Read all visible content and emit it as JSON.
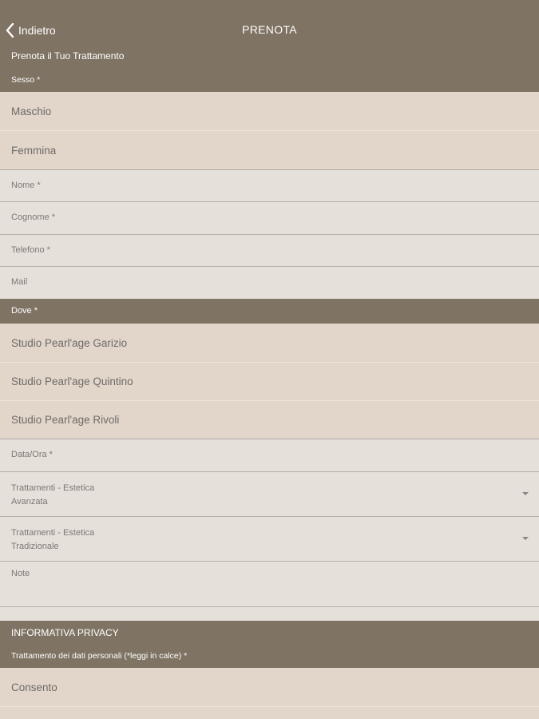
{
  "nav": {
    "back_label": "Indietro",
    "title": "PRENOTA"
  },
  "form": {
    "heading": "Prenota il Tuo Trattamento",
    "sesso": {
      "label": "Sesso *",
      "options": [
        "Maschio",
        "Femmina"
      ]
    },
    "nome": {
      "label": "Nome *"
    },
    "cognome": {
      "label": "Cognome *"
    },
    "telefono": {
      "label": "Telefono *"
    },
    "mail": {
      "label": "Mail"
    },
    "dove": {
      "label": "Dove *",
      "options": [
        "Studio Pearl'age Garizio",
        "Studio Pearl'age Quintino",
        "Studio Pearl'age Rivoli"
      ]
    },
    "data_ora": {
      "label": "Data/Ora *"
    },
    "trattamenti_avanzata": {
      "label": "Trattamenti - Estetica\nAvanzata"
    },
    "trattamenti_tradizionale": {
      "label": "Trattamenti - Estetica\nTradizionale"
    },
    "note": {
      "label": "Note"
    },
    "privacy": {
      "heading": "INFORMATIVA PRIVACY",
      "label": "Trattamento dei dati personali (*leggi in calce) *",
      "options": [
        "Consento"
      ]
    }
  },
  "colors": {
    "header_bg": "#7f7364",
    "option_bg": "#e2d6cb",
    "field_bg": "#e6e0db"
  }
}
